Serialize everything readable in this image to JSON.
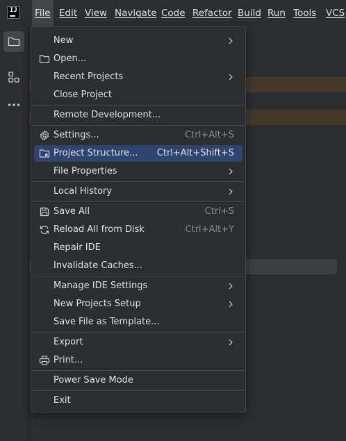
{
  "menubar": {
    "items": [
      "File",
      "Edit",
      "View",
      "Navigate",
      "Code",
      "Refactor",
      "Build",
      "Run",
      "Tools",
      "VCS"
    ],
    "logo_text": "IJ"
  },
  "file_menu": {
    "groups": [
      [
        {
          "label": "New",
          "submenu": true
        },
        {
          "label": "Open...",
          "icon": "folder-icon"
        },
        {
          "label": "Recent Projects",
          "submenu": true
        },
        {
          "label": "Close Project"
        }
      ],
      [
        {
          "label": "Remote Development..."
        }
      ],
      [
        {
          "label": "Settings...",
          "shortcut": "Ctrl+Alt+S",
          "icon": "gear-icon"
        },
        {
          "label": "Project Structure...",
          "shortcut": "Ctrl+Alt+Shift+S",
          "icon": "project-structure-icon",
          "selected": true
        },
        {
          "label": "File Properties",
          "submenu": true
        }
      ],
      [
        {
          "label": "Local History",
          "submenu": true
        }
      ],
      [
        {
          "label": "Save All",
          "shortcut": "Ctrl+S",
          "icon": "save-icon"
        },
        {
          "label": "Reload All from Disk",
          "shortcut": "Ctrl+Alt+Y",
          "icon": "reload-icon"
        },
        {
          "label": "Repair IDE"
        },
        {
          "label": "Invalidate Caches..."
        }
      ],
      [
        {
          "label": "Manage IDE Settings",
          "submenu": true
        },
        {
          "label": "New Projects Setup",
          "submenu": true
        },
        {
          "label": "Save File as Template..."
        }
      ],
      [
        {
          "label": "Export",
          "submenu": true
        },
        {
          "label": "Print...",
          "icon": "print-icon"
        }
      ],
      [
        {
          "label": "Power Save Mode"
        }
      ],
      [
        {
          "label": "Exit"
        }
      ]
    ]
  },
  "colors": {
    "background": "#2b2d30",
    "selection": "#2e436e",
    "text": "#dfe1e5",
    "shortcut": "#868a91",
    "separator": "#43454a"
  }
}
